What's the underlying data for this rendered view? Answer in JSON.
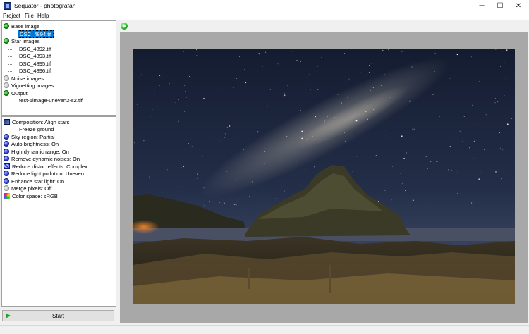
{
  "window": {
    "title": "Sequator - photografan",
    "controls": {
      "minimize": "─",
      "maximize": "☐",
      "close": "✕"
    }
  },
  "menu": [
    "Project",
    "File",
    "Help"
  ],
  "tree": {
    "base_image": {
      "label": "Base image",
      "file": "DSC_4894.tif"
    },
    "star_images": {
      "label": "Star images",
      "files": [
        "DSC_4892.tif",
        "DSC_4893.tif",
        "DSC_4895.tif",
        "DSC_4896.tif"
      ]
    },
    "noise_images": "Noise images",
    "vignetting_images": "Vignetting images",
    "output": {
      "label": "Output",
      "file": "test-5image-uneven2-s2.tif"
    }
  },
  "settings": {
    "composition": "Composition: Align stars",
    "freeze_ground": "Freeze ground",
    "sky_region": "Sky region: Partial",
    "auto_brightness": "Auto brightness: On",
    "hdr": "High dynamic range: On",
    "remove_noises": "Remove dynamic noises: On",
    "reduce_distortion": "Reduce distor. effects: Complex",
    "reduce_pollution": "Reduce light pollution: Uneven",
    "enhance_starlight": "Enhance star light: On",
    "merge_pixels": "Merge pixels: Off",
    "color_space": "Color space: sRGB"
  },
  "start_label": "Start",
  "colors": {
    "selection": "#0078d7",
    "bullet_green": "#14a614",
    "bullet_blue": "#2a3fd8",
    "frame_gray": "#a8a8a8"
  }
}
